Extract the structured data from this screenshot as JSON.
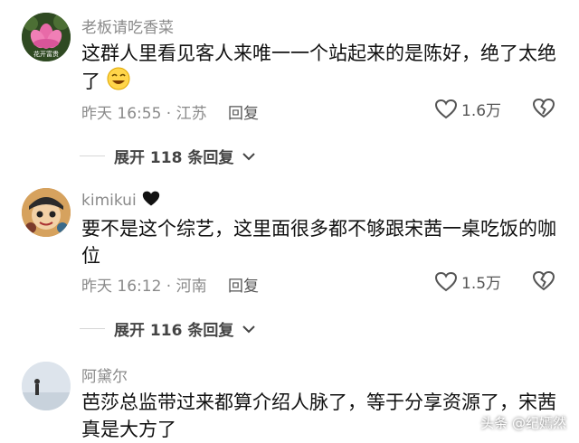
{
  "comments": [
    {
      "username": "老板请吃香菜",
      "text": "这群人里看见客人来唯一一个站起来的是陈好，绝了太绝了",
      "time_location": "昨天 16:55 · 江苏",
      "reply_label": "回复",
      "likes": "1.6万",
      "avatar_label": "花开富贵",
      "expand_label": "展开 118 条回复",
      "avatar_icon": "lotus-avatar"
    },
    {
      "username": "kimikui",
      "text": "要不是这个综艺，这里面很多都不够跟宋茜一桌吃饭的咖位",
      "time_location": "昨天 16:12 · 河南",
      "reply_label": "回复",
      "likes": "1.5万",
      "expand_label": "展开 116 条回复",
      "avatar_icon": "cartoon-avatar"
    },
    {
      "username": "阿黛尔",
      "text": "芭莎总监带过来都算介绍人脉了，等于分享资源了，宋茜真是大方了",
      "avatar_icon": "person-beach-avatar"
    }
  ],
  "watermark": "头条 @纪嫣然",
  "colors": {
    "meta": "#8a8a8a",
    "text": "#111111",
    "background": "#ffffff"
  }
}
